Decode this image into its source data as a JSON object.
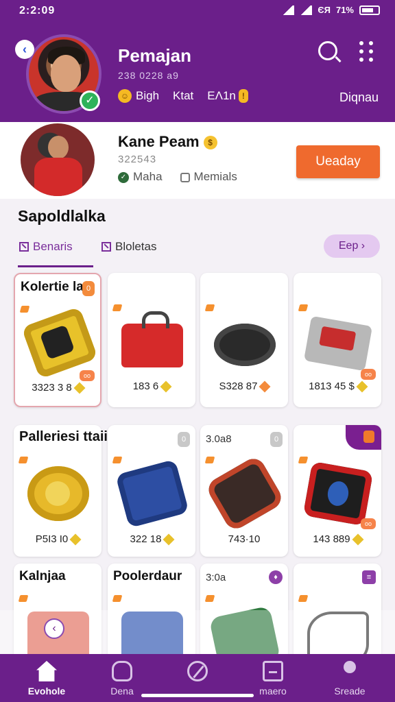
{
  "status": {
    "time": "2:2:09",
    "battery_text": "71%",
    "extra": "ЄЯ"
  },
  "header": {
    "name": "Pemajan",
    "sub": "238 0228 a9",
    "stats": [
      "Bigh",
      "Ktat",
      "EΛ1n"
    ],
    "right_label": "Diqnau"
  },
  "profile": {
    "name": "Kane Peam",
    "id": "322543",
    "meta": [
      "Maha",
      "Memials"
    ],
    "action_button": "Ueaday"
  },
  "section": {
    "title": "Sapoldlalka",
    "tabs": [
      "Benaris",
      "Bloletas"
    ],
    "see_more": "Eep ›"
  },
  "grid": {
    "row1": [
      {
        "title": "Kolertie la",
        "badge": "0",
        "price": "3323 3 8"
      },
      {
        "title": "",
        "badge": "",
        "price": "183 6"
      },
      {
        "title": "",
        "badge": "",
        "price": "S328 87"
      },
      {
        "title": "",
        "badge": "",
        "price": "1813 45 $"
      }
    ],
    "row2": [
      {
        "title": "Palleriesi ttaiias",
        "badge": "0",
        "price": "P5I3 I0"
      },
      {
        "title": "",
        "badge": "",
        "price": "322 18"
      },
      {
        "title": "3.0a8",
        "badge": "0",
        "price": "743·10"
      },
      {
        "title": "",
        "badge": "",
        "price": "143 889"
      }
    ],
    "row3": [
      {
        "title": "Kalnjaa"
      },
      {
        "title": "Poolerdaur"
      },
      {
        "title": "3:0a"
      },
      {
        "title": ""
      }
    ]
  },
  "bottom_nav": [
    {
      "label": "Evohole",
      "icon": "home-icon"
    },
    {
      "label": "Dena",
      "icon": "bag-icon"
    },
    {
      "label": "",
      "icon": "compass-icon"
    },
    {
      "label": "maero",
      "icon": "document-icon"
    },
    {
      "label": "Sreade",
      "icon": "profile-icon"
    }
  ]
}
